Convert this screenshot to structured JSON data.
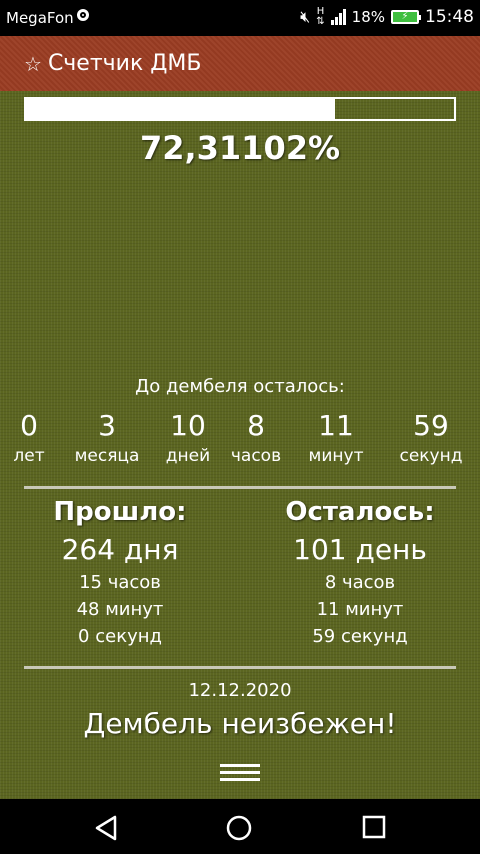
{
  "status_bar": {
    "carrier": "MegaFon",
    "network_type": "H",
    "battery_percent": "18%",
    "time": "15:48",
    "icons": [
      "carrier-logo-icon",
      "mute-icon",
      "signal-icon",
      "battery-charging-icon"
    ]
  },
  "toolbar": {
    "title": "Счетчик ДМБ",
    "icon": "star-icon"
  },
  "progress": {
    "fraction": 0.7231102,
    "percent_text": "72,31102%"
  },
  "countdown": {
    "label": "До дембеля осталось:",
    "units": [
      {
        "value": "0",
        "name": "лет"
      },
      {
        "value": "3",
        "name": "месяца"
      },
      {
        "value": "10",
        "name": "дней"
      },
      {
        "value": "8",
        "name": "часов"
      },
      {
        "value": "11",
        "name": "минут"
      },
      {
        "value": "59",
        "name": "секунд"
      }
    ]
  },
  "passed": {
    "heading": "Прошло:",
    "days": "264 дня",
    "hours": "15 часов",
    "minutes": "48 минут",
    "seconds": "0 секунд"
  },
  "left": {
    "heading": "Осталось:",
    "days": "101 день",
    "hours": "8 часов",
    "minutes": "11 минут",
    "seconds": "59 секунд"
  },
  "footer": {
    "date": "12.12.2020",
    "motto": "Дембель неизбежен!"
  },
  "nav": {
    "icons": [
      "back-icon",
      "home-icon",
      "recents-icon"
    ]
  },
  "colors": {
    "toolbar": "#9a3c22",
    "background": "#5b6520",
    "text": "#ffffff"
  }
}
